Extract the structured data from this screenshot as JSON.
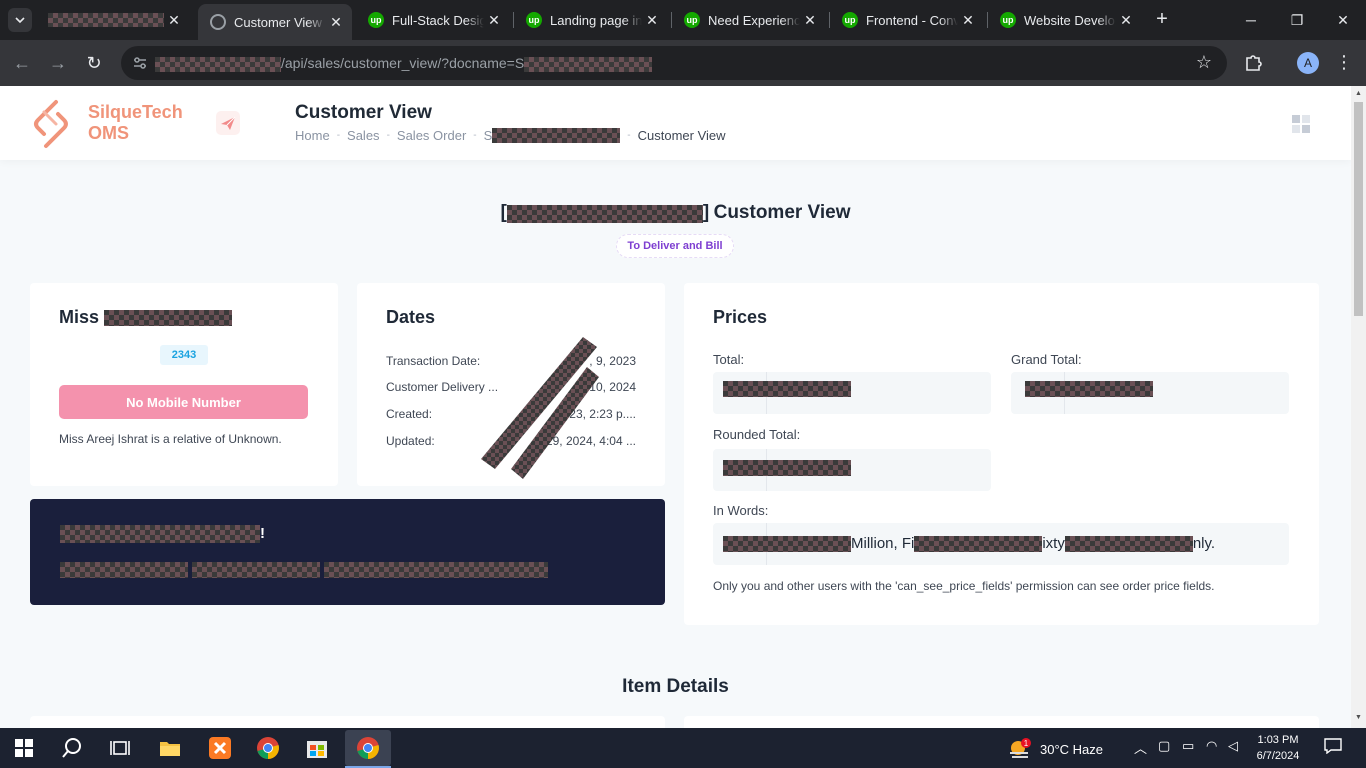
{
  "browser": {
    "tabs": [
      {
        "title": "",
        "redacted": true
      },
      {
        "title": "Customer View |",
        "active": true
      },
      {
        "title": "Full-Stack Desig"
      },
      {
        "title": "Landing page in"
      },
      {
        "title": "Need Experience"
      },
      {
        "title": "Frontend - Conv"
      },
      {
        "title": "Website Develop"
      }
    ],
    "upwork_favicon": "up",
    "url_path": "/api/sales/customer_view/?docname=S",
    "profile_initial": "A"
  },
  "app": {
    "brand_line1": "SilqueTech",
    "brand_line2": "OMS",
    "brand_color": "#f0947a",
    "page_heading": "Customer View",
    "breadcrumb": {
      "home": "Home",
      "sales": "Sales",
      "sales_order": "Sales Order",
      "order_prefix": "S",
      "current": "Customer View"
    }
  },
  "main": {
    "title_prefix": "[",
    "title_suffix": "Customer View",
    "status": "To Deliver and Bill",
    "customer": {
      "salutation": "Miss",
      "id": "2343",
      "mobile_button": "No Mobile Number",
      "relative_text": "Miss Areej Ishrat is a relative of Unknown."
    },
    "dates": {
      "heading": "Dates",
      "rows": [
        {
          "label": "Transaction Date:",
          "value": ", 9, 2023"
        },
        {
          "label": "Customer Delivery ...",
          "value": "10, 2024"
        },
        {
          "label": "Created:",
          "value": "2023, 2:23 p...."
        },
        {
          "label": "Updated:",
          "value": "29, 2024, 4:04 ..."
        }
      ]
    },
    "notice": {
      "line1_tail": "!"
    },
    "prices": {
      "heading": "Prices",
      "total_label": "Total:",
      "grand_total_label": "Grand Total:",
      "rounded_total_label": "Rounded Total:",
      "in_words_label": "In Words:",
      "in_words_part1": "Million, Fi",
      "in_words_part2": "ixty",
      "in_words_part3": "nly.",
      "permission_note": "Only you and other users with the 'can_see_price_fields' permission can see order price fields."
    },
    "items_heading": "Item Details"
  },
  "taskbar": {
    "weather": "30°C  Haze",
    "weather_badge": "1",
    "time": "1:03 PM",
    "date": "6/7/2024"
  }
}
